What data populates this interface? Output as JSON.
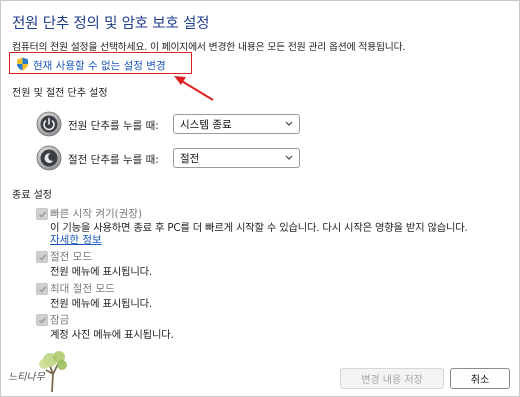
{
  "title": "전원 단추 정의 및 암호 보호 설정",
  "description": "컴퓨터의 전원 설정을 선택하세요. 이 페이지에서 변경한 내용은 모든 전원 관리 옵션에 적용됩니다.",
  "change_settings_link": "현재 사용할 수 없는 설정 변경",
  "power_section": {
    "heading": "전원 및 절전 단추 설정",
    "power_button": {
      "label": "전원 단추를 누를 때:",
      "value": "시스템 종료"
    },
    "sleep_button": {
      "label": "절전 단추를 누를 때:",
      "value": "절전"
    }
  },
  "shutdown_section": {
    "heading": "종료 설정",
    "fast_startup": {
      "title": "빠른 시작 켜기(권장)",
      "desc": "이 기능을 사용하면 종료 후 PC를 더 빠르게 시작할 수 있습니다. 다시 시작은 영향을 받지 않습니다.",
      "link": "자세한 정보"
    },
    "sleep": {
      "title": "절전 모드",
      "desc": "전원 메뉴에 표시됩니다."
    },
    "hibernate": {
      "title": "최대 절전 모드",
      "desc": "전원 메뉴에 표시됩니다."
    },
    "lock": {
      "title": "잠금",
      "desc": "계정 사진 메뉴에 표시됩니다."
    }
  },
  "buttons": {
    "save": "변경 내용 저장",
    "cancel": "취소"
  },
  "watermark_text": "느티나무",
  "colors": {
    "title": "#1e3c8c",
    "link": "#1a56b8",
    "highlight": "#e02020"
  }
}
